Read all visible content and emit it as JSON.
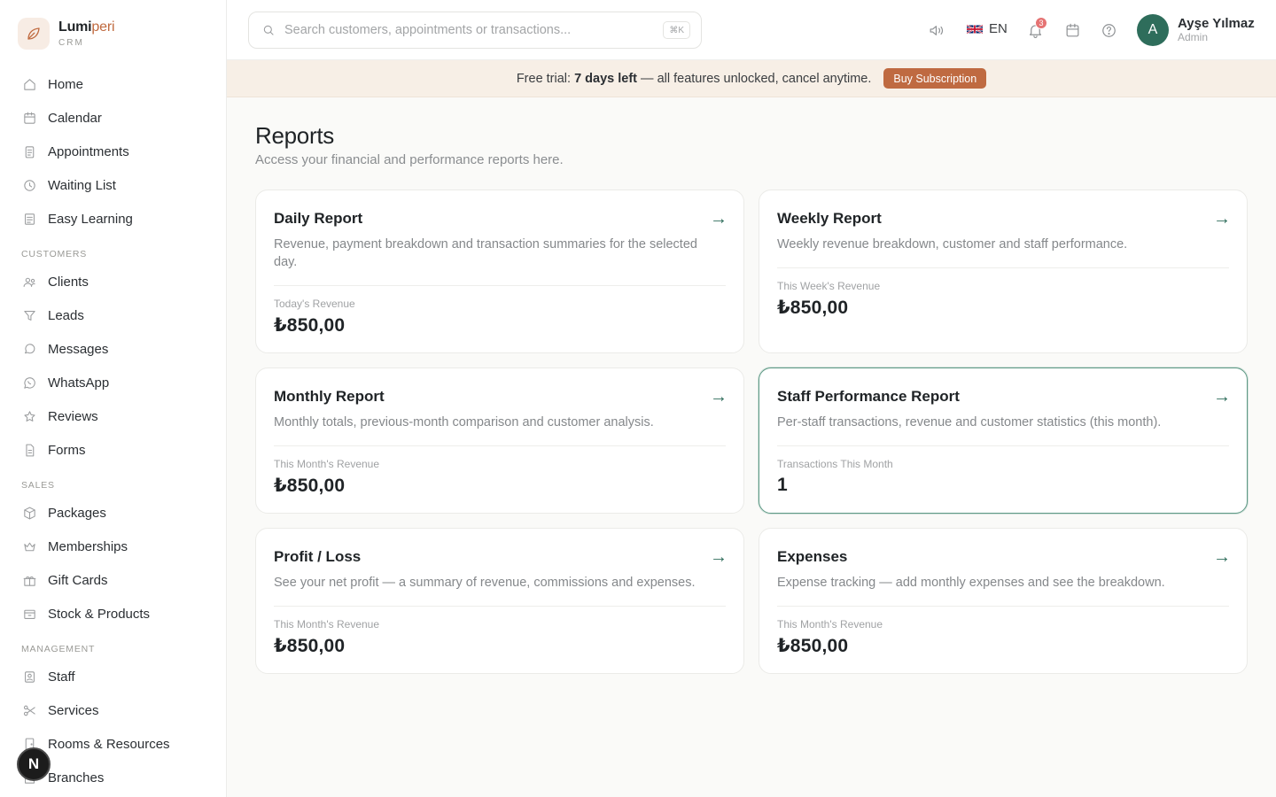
{
  "brand": {
    "name_main": "Lumi",
    "name_accent": "peri",
    "sub": "CRM"
  },
  "sidebar": {
    "items": [
      {
        "label": "Home",
        "icon": "home-icon"
      },
      {
        "label": "Calendar",
        "icon": "calendar-icon"
      },
      {
        "label": "Appointments",
        "icon": "clipboard-icon"
      },
      {
        "label": "Waiting List",
        "icon": "clock-icon"
      },
      {
        "label": "Easy Learning",
        "icon": "book-icon"
      }
    ],
    "customers_section": "CUSTOMERS",
    "customers": [
      {
        "label": "Clients",
        "icon": "users-icon"
      },
      {
        "label": "Leads",
        "icon": "funnel-icon"
      },
      {
        "label": "Messages",
        "icon": "chat-icon"
      },
      {
        "label": "WhatsApp",
        "icon": "whatsapp-icon"
      },
      {
        "label": "Reviews",
        "icon": "star-icon"
      },
      {
        "label": "Forms",
        "icon": "form-icon"
      }
    ],
    "sales_section": "SALES",
    "sales": [
      {
        "label": "Packages",
        "icon": "package-icon"
      },
      {
        "label": "Memberships",
        "icon": "crown-icon"
      },
      {
        "label": "Gift Cards",
        "icon": "gift-icon"
      },
      {
        "label": "Stock & Products",
        "icon": "box-icon"
      }
    ],
    "management_section": "MANAGEMENT",
    "management": [
      {
        "label": "Staff",
        "icon": "staff-icon"
      },
      {
        "label": "Services",
        "icon": "scissors-icon"
      },
      {
        "label": "Rooms & Resources",
        "icon": "door-icon"
      },
      {
        "label": "Branches",
        "icon": "building-icon"
      }
    ]
  },
  "fab": {
    "label": "N"
  },
  "topbar": {
    "search_placeholder": "Search customers, appointments or transactions...",
    "search_shortcut": "⌘K",
    "language": "EN",
    "notification_count": "3",
    "user_initial": "A",
    "user_name": "Ayşe Yılmaz",
    "user_role": "Admin"
  },
  "banner": {
    "prefix": "Free trial: ",
    "days": "7 days left",
    "suffix": " — all features unlocked, cancel anytime.",
    "button": "Buy Subscription"
  },
  "page": {
    "title": "Reports",
    "subtitle": "Access your financial and performance reports here."
  },
  "cards": [
    {
      "title": "Daily Report",
      "desc": "Revenue, payment breakdown and transaction summaries for the selected day.",
      "label": "Today's Revenue",
      "value": "₺850,00"
    },
    {
      "title": "Weekly Report",
      "desc": "Weekly revenue breakdown, customer and staff performance.",
      "label": "This Week's Revenue",
      "value": "₺850,00"
    },
    {
      "title": "Monthly Report",
      "desc": "Monthly totals, previous-month comparison and customer analysis.",
      "label": "This Month's Revenue",
      "value": "₺850,00"
    },
    {
      "title": "Staff Performance Report",
      "desc": "Per-staff transactions, revenue and customer statistics (this month).",
      "label": "Transactions This Month",
      "value": "1"
    },
    {
      "title": "Profit / Loss",
      "desc": "See your net profit — a summary of revenue, commissions and expenses.",
      "label": "This Month's Revenue",
      "value": "₺850,00"
    },
    {
      "title": "Expenses",
      "desc": "Expense tracking — add monthly expenses and see the breakdown.",
      "label": "This Month's Revenue",
      "value": "₺850,00"
    }
  ],
  "colors": {
    "accent": "#2e6d5b",
    "brand": "#c06a3f",
    "banner_bg": "#f7efe6",
    "button": "#bf6a41"
  }
}
